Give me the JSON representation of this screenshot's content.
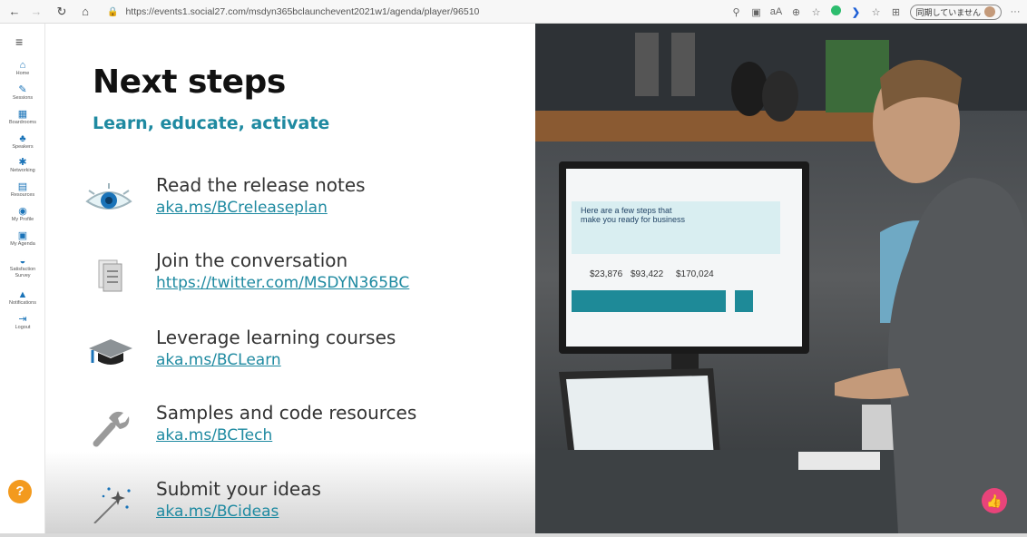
{
  "browser": {
    "url": "https://events1.social27.com/msdyn365bclaunchevent2021w1/agenda/player/96510",
    "sync_label": "同期していません",
    "more": "···"
  },
  "sidebar": {
    "items": [
      {
        "label": "Home",
        "icon": "home-icon"
      },
      {
        "label": "Sessions",
        "icon": "pencil-icon"
      },
      {
        "label": "Boardrooms",
        "icon": "boardroom-icon"
      },
      {
        "label": "Speakers",
        "icon": "speakers-icon"
      },
      {
        "label": "Networking",
        "icon": "networking-icon"
      },
      {
        "label": "Resources",
        "icon": "resources-icon"
      },
      {
        "label": "My Profile",
        "icon": "profile-icon"
      },
      {
        "label": "My Agenda",
        "icon": "agenda-icon"
      },
      {
        "label": "Satisfaction Survey",
        "icon": "survey-icon"
      },
      {
        "label": "Notifications",
        "icon": "bell-icon"
      },
      {
        "label": "Logout",
        "icon": "logout-icon"
      }
    ],
    "help": "?"
  },
  "slide": {
    "title": "Next steps",
    "subtitle": "Learn, educate, activate",
    "steps": [
      {
        "text": "Read the release notes",
        "link": "aka.ms/BCreleaseplan",
        "icon": "eye-icon"
      },
      {
        "text": "Join the conversation",
        "link": "https://twitter.com/MSDYN365BC",
        "icon": "document-icon"
      },
      {
        "text": "Leverage learning courses",
        "link": "aka.ms/BCLearn",
        "icon": "graduation-cap-icon"
      },
      {
        "text": "Samples and code resources",
        "link": "aka.ms/BCTech",
        "icon": "wrench-icon"
      },
      {
        "text": "Submit your ideas",
        "link": "aka.ms/BCideas",
        "icon": "magic-wand-icon"
      }
    ]
  },
  "photo": {
    "screen_heading": "Here are a few steps that make you ready for business",
    "kpis": [
      "$23,876",
      "$93,422",
      "$170,024"
    ]
  },
  "colors": {
    "accent": "#1f8aa1",
    "help": "#f39a1e",
    "like": "#e8447a"
  }
}
